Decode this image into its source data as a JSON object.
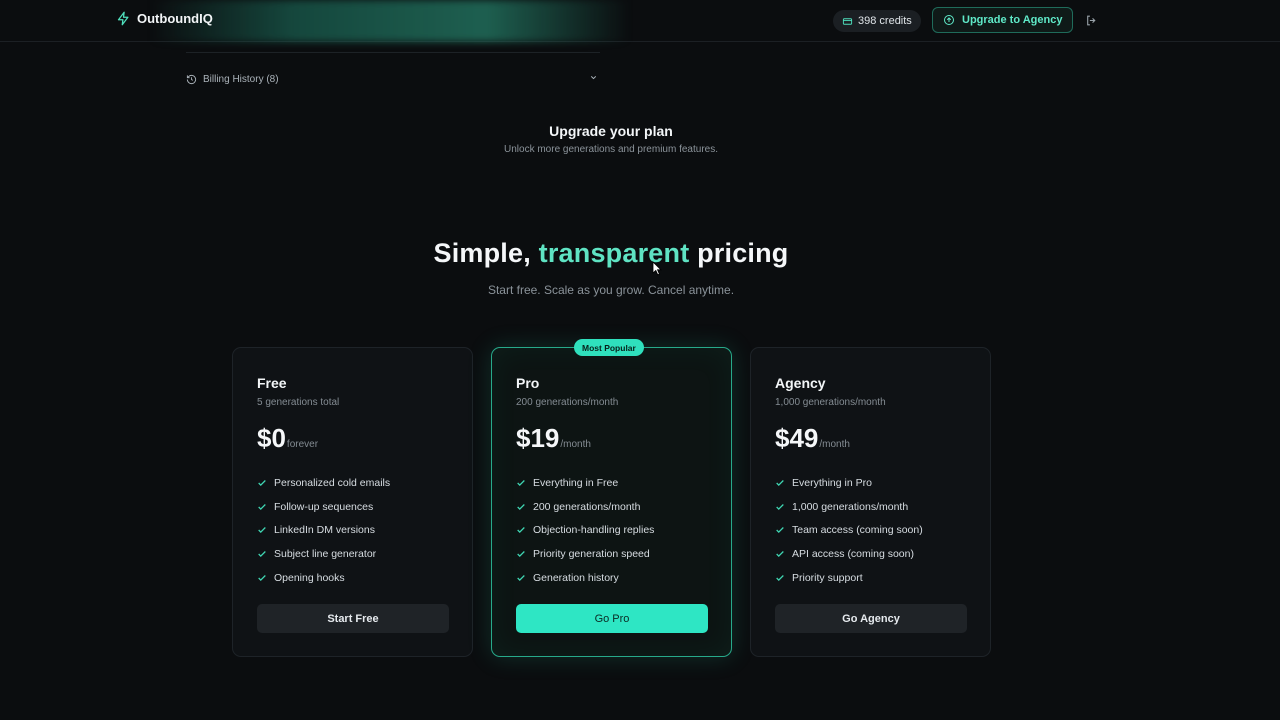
{
  "brand": {
    "name": "OutboundIQ",
    "icon": "zap-icon"
  },
  "header": {
    "credits": "398 credits",
    "upgrade_label": "Upgrade to Agency",
    "logout_icon": "logout-icon"
  },
  "billing": {
    "label": "Billing History (8)"
  },
  "upgrade_section": {
    "title": "Upgrade your plan",
    "subtitle": "Unlock more generations and premium features."
  },
  "hero": {
    "title_before": "Simple, ",
    "title_accent": "transparent",
    "title_after": " pricing",
    "subtitle": "Start free. Scale as you grow. Cancel anytime."
  },
  "colors": {
    "accent": "#2ee6c4",
    "background": "#0b0d0f",
    "card": "#0f1215"
  },
  "plans": [
    {
      "name": "Free",
      "generations": "5 generations total",
      "price": "$0",
      "period": "forever",
      "features": [
        "Personalized cold emails",
        "Follow-up sequences",
        "LinkedIn DM versions",
        "Subject line generator",
        "Opening hooks"
      ],
      "cta": "Start Free"
    },
    {
      "name": "Pro",
      "badge": "Most Popular",
      "generations": "200 generations/month",
      "price": "$19",
      "period": "/month",
      "features": [
        "Everything in Free",
        "200 generations/month",
        "Objection-handling replies",
        "Priority generation speed",
        "Generation history"
      ],
      "cta": "Go Pro"
    },
    {
      "name": "Agency",
      "generations": "1,000 generations/month",
      "price": "$49",
      "period": "/month",
      "features": [
        "Everything in Pro",
        "1,000 generations/month",
        "Team access (coming soon)",
        "API access (coming soon)",
        "Priority support"
      ],
      "cta": "Go Agency"
    }
  ]
}
